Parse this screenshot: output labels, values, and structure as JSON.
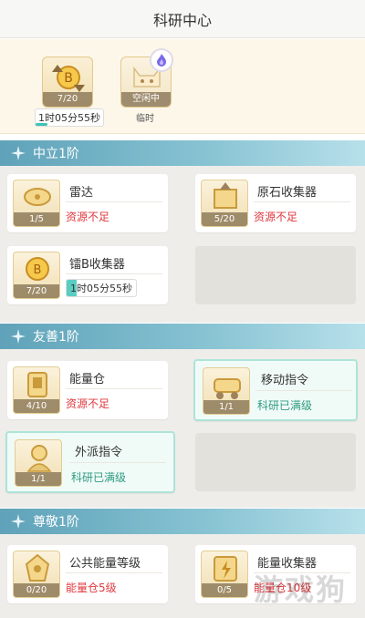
{
  "header": {
    "title": "科研中心"
  },
  "queue": {
    "slot1": {
      "count": "7/20",
      "timer": "1时05分55秒"
    },
    "slot2": {
      "label": "空闲中",
      "caption": "临时"
    }
  },
  "sections": [
    {
      "title": "中立1阶",
      "cards": [
        {
          "name": "雷达",
          "level": "1/5",
          "status": "资源不足"
        },
        {
          "name": "原石收集器",
          "level": "5/20",
          "status": "资源不足"
        },
        {
          "name": "镭B收集器",
          "level": "7/20",
          "timer": "1时05分55秒"
        }
      ]
    },
    {
      "title": "友善1阶",
      "cards": [
        {
          "name": "能量仓",
          "level": "4/10",
          "status": "资源不足"
        },
        {
          "name": "移动指令",
          "level": "1/1",
          "status": "科研已满级"
        },
        {
          "name": "外派指令",
          "level": "1/1",
          "status": "科研已满级"
        }
      ]
    },
    {
      "title": "尊敬1阶",
      "cards": [
        {
          "name": "公共能量等级",
          "level": "0/20",
          "status": "能量仓5级"
        },
        {
          "name": "能量收集器",
          "level": "0/5",
          "status": "能量仓10级"
        }
      ]
    }
  ],
  "watermark": "游戏狗",
  "colors": {
    "accent_teal": "#5fa2b9",
    "status_red": "#e0393f",
    "status_green": "#2f9b7f",
    "icon_gold": "#f1dfb2"
  }
}
